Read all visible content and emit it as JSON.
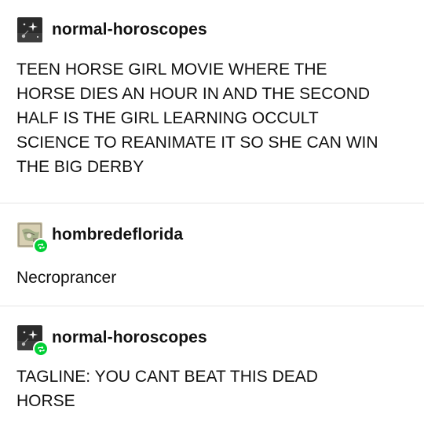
{
  "posts": [
    {
      "username": "normal-horoscopes",
      "avatar": "dark-sky-sparkle-avatar",
      "reblogged": false,
      "body": "TEEN HORSE GIRL MOVIE WHERE THE\nHORSE DIES AN HOUR IN AND THE SECOND\nHALF IS THE GIRL LEARNING OCCULT\nSCIENCE TO REANIMATE IT SO SHE CAN WIN\nTHE BIG DERBY"
    },
    {
      "username": "hombredeflorida",
      "avatar": "map-photo-avatar",
      "reblogged": true,
      "body": "Necroprancer"
    },
    {
      "username": "normal-horoscopes",
      "avatar": "dark-sky-sparkle-avatar",
      "reblogged": true,
      "body": "TAGLINE: YOU CANT BEAT THIS DEAD\nHORSE"
    }
  ],
  "colors": {
    "reblog_badge": "#00cf35",
    "divider": "#e4e4e4",
    "text": "#111111"
  }
}
